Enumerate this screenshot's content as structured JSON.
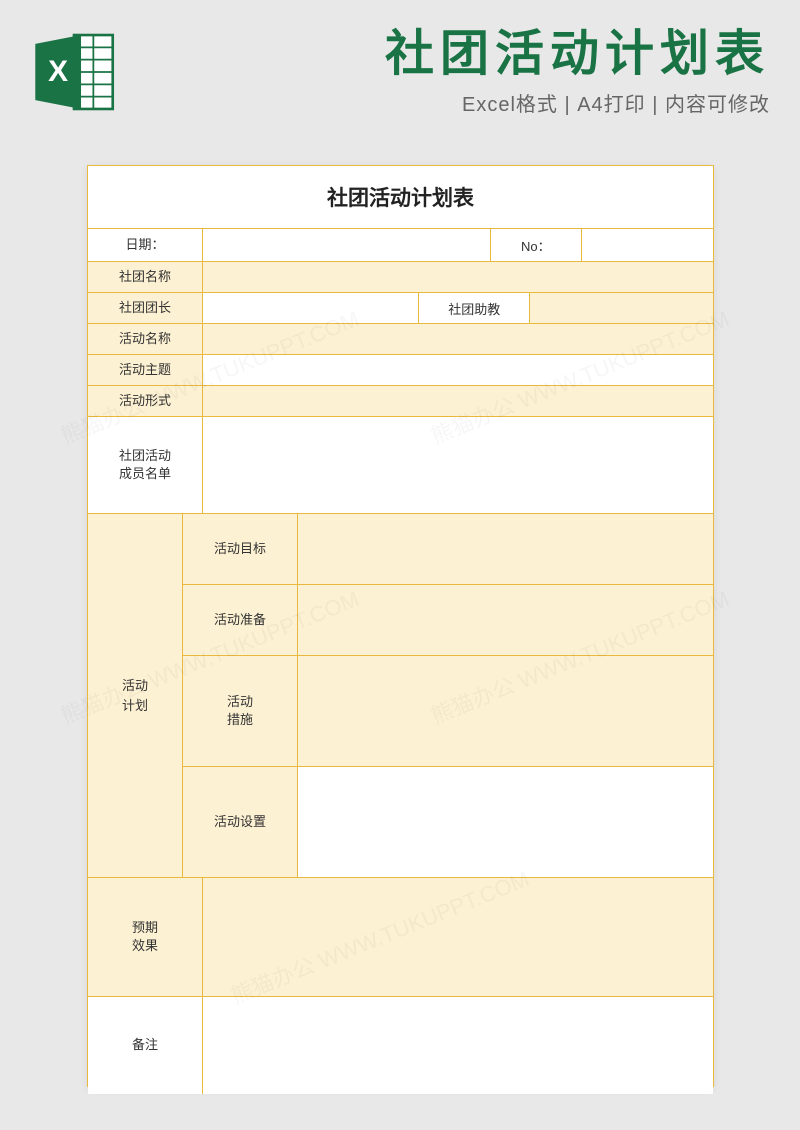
{
  "header": {
    "title_main": "社团活动计划表",
    "subtitle_parts": [
      "Excel格式",
      "A4打印",
      "内容可修改"
    ],
    "separator": " | "
  },
  "form": {
    "title": "社团活动计划表",
    "date_label": "日期：",
    "no_label": "No：",
    "club_name_label": "社团名称",
    "leader_label": "社团团长",
    "assistant_label": "社团助教",
    "activity_name_label": "活动名称",
    "activity_theme_label": "活动主题",
    "activity_form_label": "活动形式",
    "member_list_label": "社团活动\n成员名单",
    "plan_label": "活动\n计划",
    "plan_goal_label": "活动目标",
    "plan_prep_label": "活动准备",
    "plan_measure_label": "活动\n措施",
    "plan_setting_label": "活动设置",
    "expected_label": "预期\n效果",
    "remarks_label": "备注"
  },
  "watermarks": [
    "熊猫办公 WWW.TUKUPPT.COM",
    "熊猫办公 WWW.TUKUPPT.COM",
    "熊猫办公 WWW.TUKUPPT.COM",
    "熊猫办公 WWW.TUKUPPT.COM",
    "熊猫办公 WWW.TUKUPPT.COM"
  ]
}
